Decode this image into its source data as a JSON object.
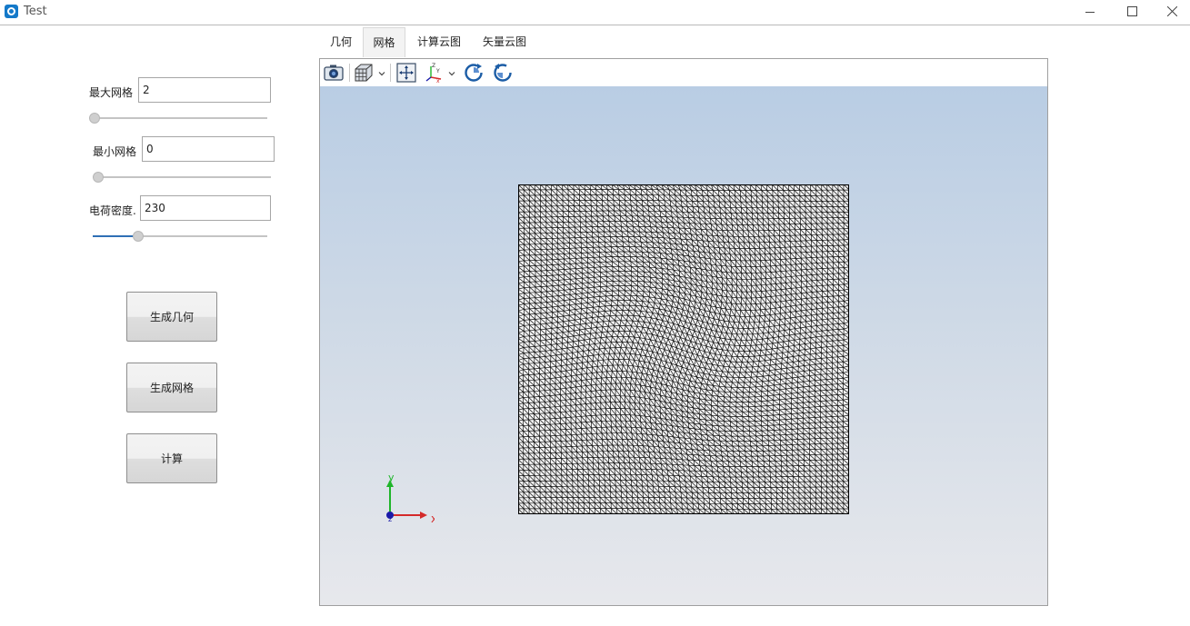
{
  "window": {
    "title": "Test",
    "icons": {
      "app": "app-logo-icon",
      "minimize": "minimize-icon",
      "maximize": "maximize-icon",
      "close": "close-icon"
    }
  },
  "controls": {
    "max_mesh": {
      "label": "最大网格",
      "value": "2",
      "slider_fraction": 0.0
    },
    "min_mesh": {
      "label": "最小网格",
      "value": "0",
      "slider_fraction": 0.0
    },
    "charge_density": {
      "label": "电荷密度.",
      "value": "230",
      "slider_fraction": 0.23
    }
  },
  "buttons": {
    "generate_geometry": "生成几何",
    "generate_mesh": "生成网格",
    "compute": "计算"
  },
  "tabs": [
    {
      "label": "几何",
      "active": false
    },
    {
      "label": "网格",
      "active": true
    },
    {
      "label": "计算云图",
      "active": false
    },
    {
      "label": "矢量云图",
      "active": false
    }
  ],
  "toolbar": {
    "icons": [
      "camera-icon",
      "view-cube-icon",
      "dropdown-caret-icon",
      "fit-view-icon",
      "axes-orientation-icon",
      "dropdown-caret-icon",
      "rotate-cw-icon",
      "rotate-ccw-icon"
    ]
  },
  "axes_triad": {
    "x_label": "x",
    "y_label": "y",
    "z_label": "z"
  },
  "colors": {
    "accent": "#2f6fb5",
    "viewport_top": "#b9cde4",
    "viewport_bottom": "#e7e8ec",
    "axis_x": "#d42a2a",
    "axis_y": "#1fb52a",
    "axis_z": "#1a1aa8"
  }
}
